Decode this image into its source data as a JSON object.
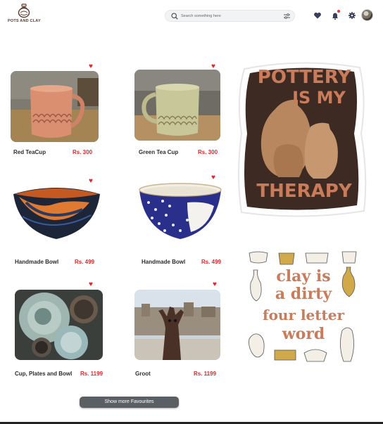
{
  "header": {
    "logo_text": "POTS AND CLAY",
    "search_placeholder": "Search something here"
  },
  "products": [
    {
      "name": "Red TeaCup",
      "price": "Rs. 300"
    },
    {
      "name": "Green Tea Cup",
      "price": "Rs. 300"
    },
    {
      "name": "Handmade Bowl",
      "price": "Rs. 499"
    },
    {
      "name": "Handmade Bowl",
      "price": "Rs. 499"
    },
    {
      "name": "Cup, Plates and Bowl",
      "price": "Rs. 1199"
    },
    {
      "name": "Groot",
      "price": "Rs. 1199"
    }
  ],
  "stickers": {
    "sticker1": {
      "line1": "POTTERY",
      "line2": "IS MY",
      "line3": "THERAPY"
    },
    "sticker2": {
      "line1": "clay is",
      "line2": "a dirty",
      "line3": "four letter",
      "line4": "word"
    }
  },
  "show_more_label": "Show more Favourites",
  "colors": {
    "accent": "#e0262b",
    "button": "#5a5f63",
    "sticker_brown": "#3d2a22",
    "sticker_text": "#c97b5a"
  }
}
